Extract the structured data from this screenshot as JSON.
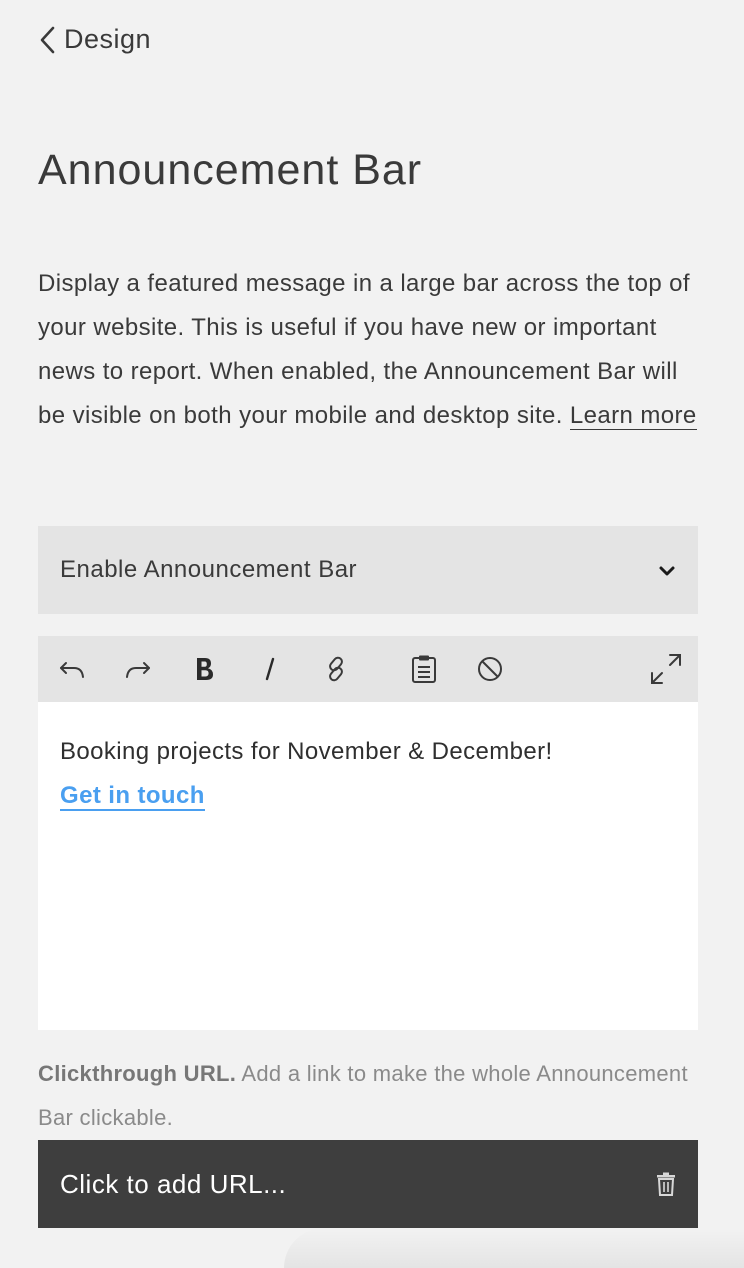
{
  "nav": {
    "back_label": "Design"
  },
  "page": {
    "title": "Announcement Bar",
    "description": "Display a featured message in a large bar across the top of your website. This is useful if you have new or important news to report. When enabled, the Announcement Bar will be visible on both your mobile and desktop site.",
    "learn_more": "Learn more"
  },
  "enable_select": {
    "selected": "Enable Announcement Bar"
  },
  "editor": {
    "toolbar": [
      "undo-icon",
      "redo-icon",
      "bold-icon",
      "italic-icon",
      "link-icon",
      "paste-icon",
      "clear-format-icon",
      "expand-icon"
    ],
    "text": "Booking projects for November & December!",
    "link_text": "Get in touch",
    "link_color": "#4a9ff0"
  },
  "clickthrough": {
    "label": "Clickthrough URL.",
    "help": "Add a link to make the whole Announcement Bar clickable.",
    "placeholder": "Click to add URL..."
  },
  "colors": {
    "background": "#f2f2f2",
    "panel": "#e4e4e4",
    "dark_bar": "#3e3e3e",
    "text": "#3a3a3a"
  }
}
